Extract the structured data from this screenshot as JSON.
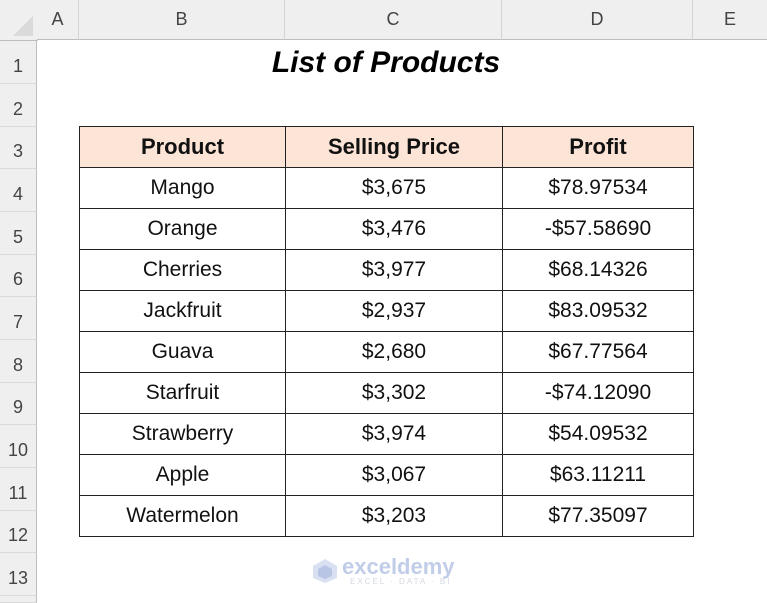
{
  "sheet": {
    "columns": [
      "A",
      "B",
      "C",
      "D",
      "E"
    ],
    "rows": [
      "1",
      "2",
      "3",
      "4",
      "5",
      "6",
      "7",
      "8",
      "9",
      "10",
      "11",
      "12",
      "13"
    ],
    "title": "List of Products"
  },
  "table": {
    "headers": [
      "Product",
      "Selling Price",
      "Profit"
    ],
    "rows": [
      {
        "product": "Mango",
        "price": "$3,675",
        "profit": "$78.97534"
      },
      {
        "product": "Orange",
        "price": "$3,476",
        "profit": "-$57.58690"
      },
      {
        "product": "Cherries",
        "price": "$3,977",
        "profit": "$68.14326"
      },
      {
        "product": "Jackfruit",
        "price": "$2,937",
        "profit": "$83.09532"
      },
      {
        "product": "Guava",
        "price": "$2,680",
        "profit": "$67.77564"
      },
      {
        "product": "Starfruit",
        "price": "$3,302",
        "profit": "-$74.12090"
      },
      {
        "product": "Strawberry",
        "price": "$3,974",
        "profit": "$54.09532"
      },
      {
        "product": "Apple",
        "price": "$3,067",
        "profit": "$63.11211"
      },
      {
        "product": "Watermelon",
        "price": "$3,203",
        "profit": "$77.35097"
      }
    ],
    "header_fill": "#fce4d6"
  },
  "watermark": {
    "name": "exceldemy",
    "tagline": "EXCEL · DATA · BI"
  }
}
